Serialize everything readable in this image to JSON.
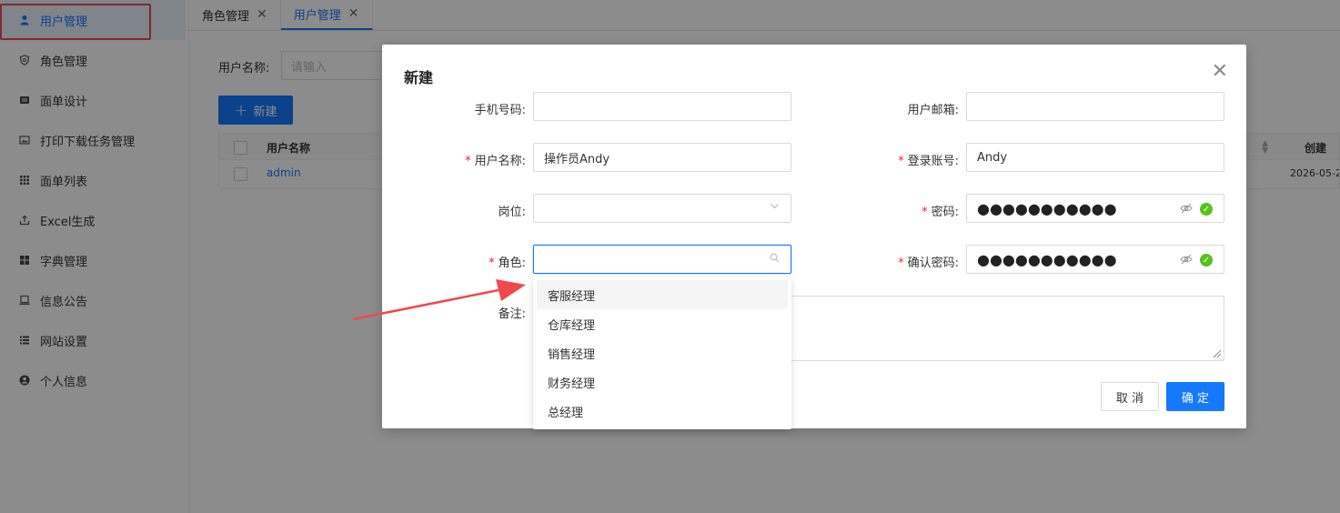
{
  "sidebar": {
    "items": [
      {
        "label": "用户管理",
        "icon": "user-icon"
      },
      {
        "label": "角色管理",
        "icon": "shield-icon"
      },
      {
        "label": "面单设计",
        "icon": "card-icon"
      },
      {
        "label": "打印下载任务管理",
        "icon": "image-icon"
      },
      {
        "label": "面单列表",
        "icon": "grid-icon"
      },
      {
        "label": "Excel生成",
        "icon": "upload-icon"
      },
      {
        "label": "字典管理",
        "icon": "table-icon"
      },
      {
        "label": "信息公告",
        "icon": "laptop-icon"
      },
      {
        "label": "网站设置",
        "icon": "list-icon"
      },
      {
        "label": "个人信息",
        "icon": "profile-icon"
      }
    ]
  },
  "tabs": [
    {
      "label": "角色管理",
      "close": "✕"
    },
    {
      "label": "用户管理",
      "close": "✕"
    }
  ],
  "main": {
    "search_label": "用户名称:",
    "search_placeholder": "请输入",
    "new_button": "新建",
    "table": {
      "headers": {
        "name": "用户名称",
        "create": "创建"
      },
      "rows": [
        {
          "name": "admin",
          "date": "2026-05-2"
        }
      ]
    }
  },
  "modal": {
    "title": "新建",
    "close": "✕",
    "fields": {
      "phone": {
        "label": "手机号码:",
        "value": ""
      },
      "email": {
        "label": "用户邮箱:",
        "value": ""
      },
      "username": {
        "label": "用户名称:",
        "value": "操作员Andy"
      },
      "account": {
        "label": "登录账号:",
        "value": "Andy"
      },
      "post": {
        "label": "岗位:",
        "value": ""
      },
      "password": {
        "label": "密码:",
        "value": "●●●●●●●●●●●"
      },
      "role": {
        "label": "角色:",
        "value": ""
      },
      "confirm_password": {
        "label": "确认密码:",
        "value": "●●●●●●●●●●●"
      },
      "remark": {
        "label": "备注:",
        "value": ""
      }
    },
    "required_mark": "*",
    "cancel_button": "取 消",
    "ok_button": "确 定"
  },
  "role_dropdown": {
    "options": [
      "客服经理",
      "仓库经理",
      "销售经理",
      "财务经理",
      "总经理"
    ],
    "hovered": "客服经理"
  },
  "colors": {
    "primary": "#1677ff",
    "required": "#f5222d",
    "success": "#52c41a",
    "annotation": "#f0484b"
  }
}
